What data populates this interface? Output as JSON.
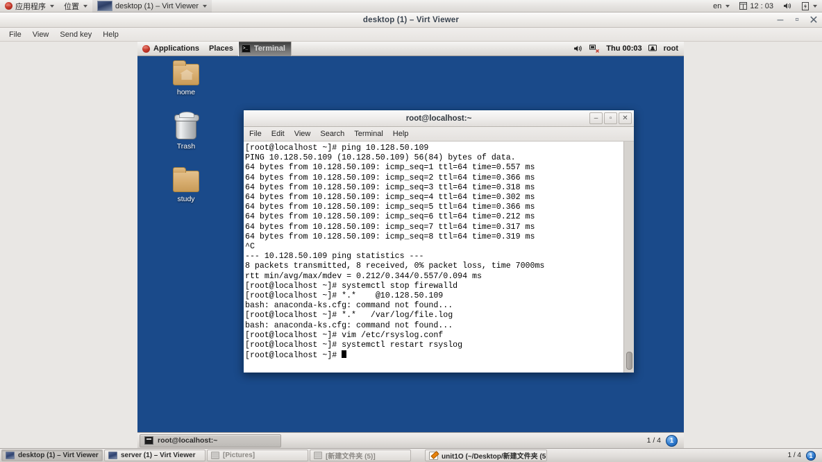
{
  "os_panel": {
    "applications_label": "应用程序",
    "places_label": "位置",
    "window_label": "desktop (1) – Virt Viewer",
    "keyboard_label": "en",
    "clock": "12 : 03"
  },
  "virt_viewer": {
    "title": "desktop (1) – Virt Viewer",
    "menu": [
      "File",
      "View",
      "Send key",
      "Help"
    ],
    "minimize_label": "–",
    "maximize_label": "▫",
    "close_label": "✕"
  },
  "vm_panel_top": {
    "applications_label": "Applications",
    "places_label": "Places",
    "active_window_label": "Terminal",
    "clock": "Thu 00:03",
    "user_label": "root"
  },
  "desktop_icons": [
    {
      "name": "home",
      "label": "home"
    },
    {
      "name": "trash",
      "label": "Trash"
    },
    {
      "name": "study",
      "label": "study"
    }
  ],
  "terminal": {
    "title": "root@localhost:~",
    "menu": [
      "File",
      "Edit",
      "View",
      "Search",
      "Terminal",
      "Help"
    ],
    "minimize_label": "–",
    "maximize_label": "▫",
    "close_label": "✕",
    "lines": [
      "[root@localhost ~]# ping 10.128.50.109",
      "PING 10.128.50.109 (10.128.50.109) 56(84) bytes of data.",
      "64 bytes from 10.128.50.109: icmp_seq=1 ttl=64 time=0.557 ms",
      "64 bytes from 10.128.50.109: icmp_seq=2 ttl=64 time=0.366 ms",
      "64 bytes from 10.128.50.109: icmp_seq=3 ttl=64 time=0.318 ms",
      "64 bytes from 10.128.50.109: icmp_seq=4 ttl=64 time=0.302 ms",
      "64 bytes from 10.128.50.109: icmp_seq=5 ttl=64 time=0.366 ms",
      "64 bytes from 10.128.50.109: icmp_seq=6 ttl=64 time=0.212 ms",
      "64 bytes from 10.128.50.109: icmp_seq=7 ttl=64 time=0.317 ms",
      "64 bytes from 10.128.50.109: icmp_seq=8 ttl=64 time=0.319 ms",
      "^C",
      "--- 10.128.50.109 ping statistics ---",
      "8 packets transmitted, 8 received, 0% packet loss, time 7000ms",
      "rtt min/avg/max/mdev = 0.212/0.344/0.557/0.094 ms",
      "[root@localhost ~]# systemctl stop firewalld",
      "[root@localhost ~]# *.*    @10.128.50.109",
      "bash: anaconda-ks.cfg: command not found...",
      "[root@localhost ~]# *.*   /var/log/file.log",
      "bash: anaconda-ks.cfg: command not found...",
      "[root@localhost ~]# vim /etc/rsyslog.conf",
      "[root@localhost ~]# systemctl restart rsyslog"
    ],
    "prompt_line": "[root@localhost ~]# "
  },
  "vm_panel_bottom": {
    "task_label": "root@localhost:~",
    "workspace_indicator": "1 / 4",
    "workspace_current": "1"
  },
  "host_taskbar": {
    "buttons": [
      {
        "name": "desktop-virt-viewer",
        "label": "desktop (1) – Virt Viewer",
        "icon": "monitor-icon",
        "state": "active"
      },
      {
        "name": "server-virt-viewer",
        "label": "server (1) – Virt Viewer",
        "icon": "monitor-icon",
        "state": "normal"
      },
      {
        "name": "pictures-folder",
        "label": "[Pictures]",
        "icon": "window-icon",
        "state": "dim"
      },
      {
        "name": "new-folder-5",
        "label": "[新建文件夹 (5)]",
        "icon": "window-icon",
        "state": "dim"
      },
      {
        "name": "unit10-editor",
        "label": "unit1O (~/Desktop/新建文件夹 (5…",
        "icon": "notepad-icon",
        "state": "normal"
      }
    ],
    "workspace_indicator": "1 / 4",
    "workspace_current": "1"
  },
  "colors": {
    "desktop_blue": "#1a4a8a",
    "panel_gray": "#e4e1de",
    "terminal_bg": "#ffffff",
    "terminal_fg": "#000000",
    "accent_blue": "#2f7bd0"
  }
}
